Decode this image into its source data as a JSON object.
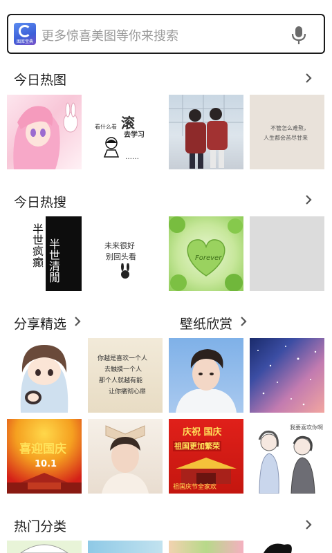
{
  "search": {
    "logo_text": "图库宝典",
    "placeholder": "更多惊喜美图等你来搜索"
  },
  "sections": {
    "today_hot_images": "今日热图",
    "today_hot_search": "今日热搜",
    "share_picks": "分享精选",
    "wallpaper": "壁纸欣赏",
    "hot_categories": "热门分类"
  },
  "thumb_text": {
    "meme_line1": "看什么看",
    "meme_big": "滚",
    "meme_line2": "去学习",
    "meme_dots": "……",
    "quote_line1": "不管怎么难熬，",
    "quote_line2": "人生都会苦尽甘来",
    "poem_col1": "半世疯癫",
    "poem_col2": "半世清閒",
    "hand_line1": "未来很好",
    "hand_line2": "别回头看",
    "forever": "Forever",
    "letter_line1": "你越是喜欢一个人",
    "letter_line2": "去触摸一个人",
    "letter_line3": "那个人就越有能",
    "letter_line4": "让你痛彻心扉",
    "national1_title": "喜迎国庆",
    "national1_sub": "10.1",
    "national2_title": "庆祝 国庆",
    "national2_banner": "祖国更加繁荣",
    "national2_footer": "祖国庆节全家欢",
    "comic_bubble": "我要喜欢你啊"
  },
  "colors": {
    "border": "#1a1a1a",
    "title": "#1e1e1e",
    "placeholder": "#9a9a9a"
  }
}
